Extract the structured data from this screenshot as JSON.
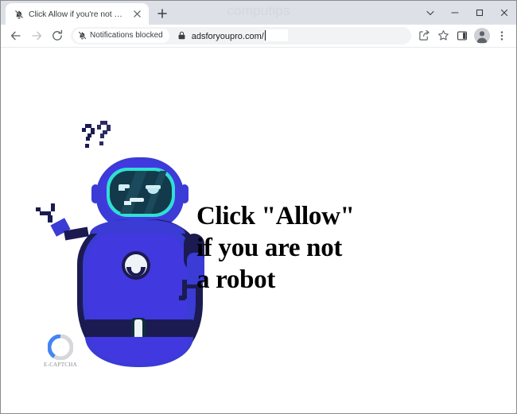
{
  "window": {
    "watermark": "computips",
    "controls": [
      {
        "name": "tab-search",
        "icon": "chevron-down-icon",
        "glyph": "⌄"
      },
      {
        "name": "minimize",
        "icon": "minimize-icon",
        "glyph": "─"
      },
      {
        "name": "maximize",
        "icon": "maximize-icon",
        "glyph": "□"
      },
      {
        "name": "close",
        "icon": "close-icon",
        "glyph": "✕"
      }
    ]
  },
  "tabstrip": {
    "tabs": [
      {
        "title": "Click Allow if you're not a robot",
        "favicon": "bell-slash-icon",
        "active": true,
        "close_label": "✕"
      }
    ],
    "new_tab_label": "+"
  },
  "toolbar": {
    "back_label": "←",
    "forward_label": "→",
    "reload_label": "↻",
    "notifications_chip": {
      "icon": "bell-slash-icon",
      "label": "Notifications blocked"
    },
    "security_icon": "lock-icon",
    "url": "adsforyoupro.com/",
    "actions": [
      {
        "name": "share-button",
        "icon": "share-icon"
      },
      {
        "name": "bookmark-button",
        "icon": "star-icon"
      },
      {
        "name": "side-panel-button",
        "icon": "side-panel-icon"
      },
      {
        "name": "profile-button",
        "icon": "avatar-icon"
      },
      {
        "name": "chrome-menu-button",
        "icon": "three-dots-icon"
      }
    ]
  },
  "page": {
    "headline_lines": [
      "Click \"Allow\"",
      "if you are not",
      "a robot"
    ],
    "ecaptcha": {
      "label": "E-CAPTCHA",
      "mark": "c-logo-icon"
    },
    "mascot": {
      "name": "confused-robot-illustration",
      "thought": "??"
    },
    "colors": {
      "robot_body": "#3b3bd6",
      "robot_body_light": "#4a47e8",
      "robot_outline": "#1b1b52",
      "visor_fill": "#123a4a",
      "visor_outline": "#2fe0d2",
      "visor_highlight": "#cfeef5",
      "shadow": "#c9cacb",
      "logo_blue": "#4285f4",
      "logo_gray": "#d5d7da",
      "tabstrip": "#dde1e7",
      "omnibox": "#f1f3f4"
    }
  }
}
